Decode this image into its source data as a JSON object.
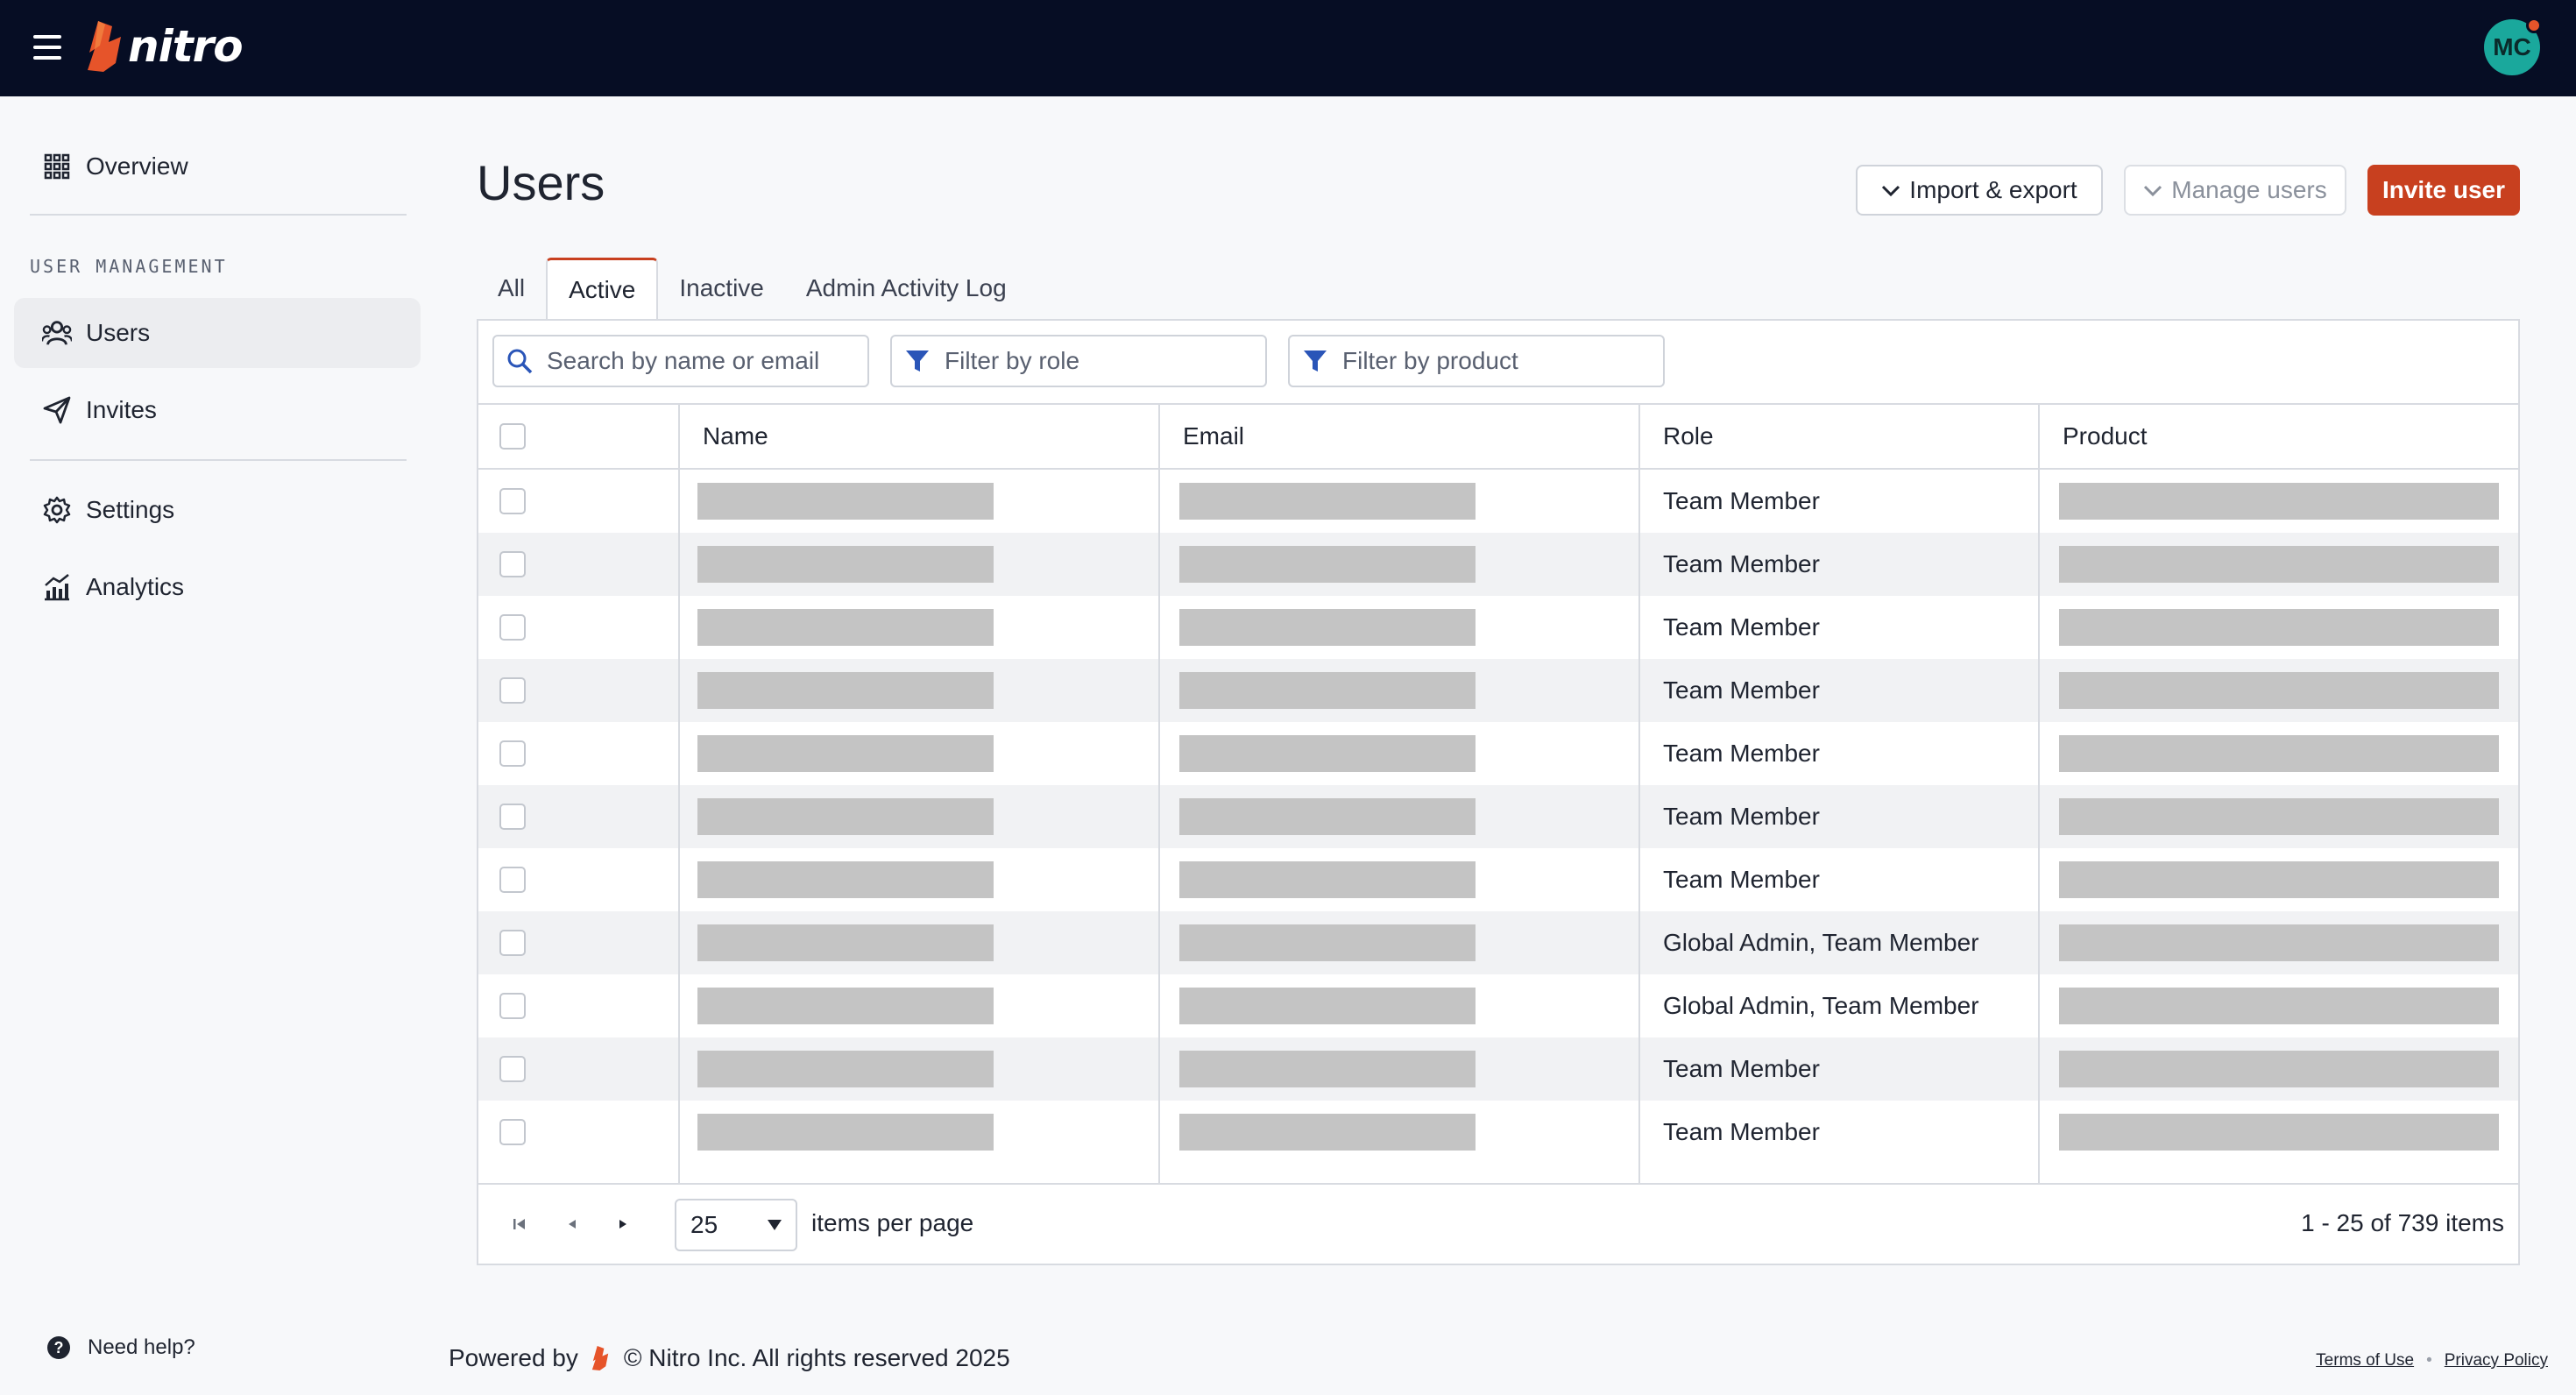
{
  "app": {
    "brand": "nitro",
    "avatar_initials": "MC",
    "colors": {
      "topbar": "#060d24",
      "accent": "#c8401f",
      "avatar": "#1aa89c"
    }
  },
  "sidebar": {
    "overview_label": "Overview",
    "section_label": "USER MANAGEMENT",
    "users_label": "Users",
    "invites_label": "Invites",
    "settings_label": "Settings",
    "analytics_label": "Analytics",
    "help_label": "Need help?"
  },
  "main": {
    "title": "Users",
    "buttons": {
      "import_export": "Import & export",
      "manage_users": "Manage users",
      "invite_user": "Invite user"
    },
    "tabs": [
      "All",
      "Active",
      "Inactive",
      "Admin Activity Log"
    ],
    "active_tab": "Active",
    "search_placeholder": "Search by name or email",
    "filter_role_placeholder": "Filter by role",
    "filter_product_placeholder": "Filter by product",
    "table": {
      "columns": [
        "Name",
        "Email",
        "Role",
        "Product"
      ],
      "rows": [
        {
          "role": "Team Member"
        },
        {
          "role": "Team Member"
        },
        {
          "role": "Team Member"
        },
        {
          "role": "Team Member"
        },
        {
          "role": "Team Member"
        },
        {
          "role": "Team Member"
        },
        {
          "role": "Team Member"
        },
        {
          "role": "Global Admin, Team Member"
        },
        {
          "role": "Global Admin, Team Member"
        },
        {
          "role": "Team Member"
        },
        {
          "role": "Team Member"
        }
      ]
    },
    "pager": {
      "page_size": "25",
      "per_page_label": "items per page",
      "count_text": "1 - 25 of 739 items"
    }
  },
  "footer": {
    "powered_by": "Powered by",
    "copyright": "© Nitro Inc. All rights reserved 2025",
    "terms": "Terms of Use",
    "privacy": "Privacy Policy"
  }
}
